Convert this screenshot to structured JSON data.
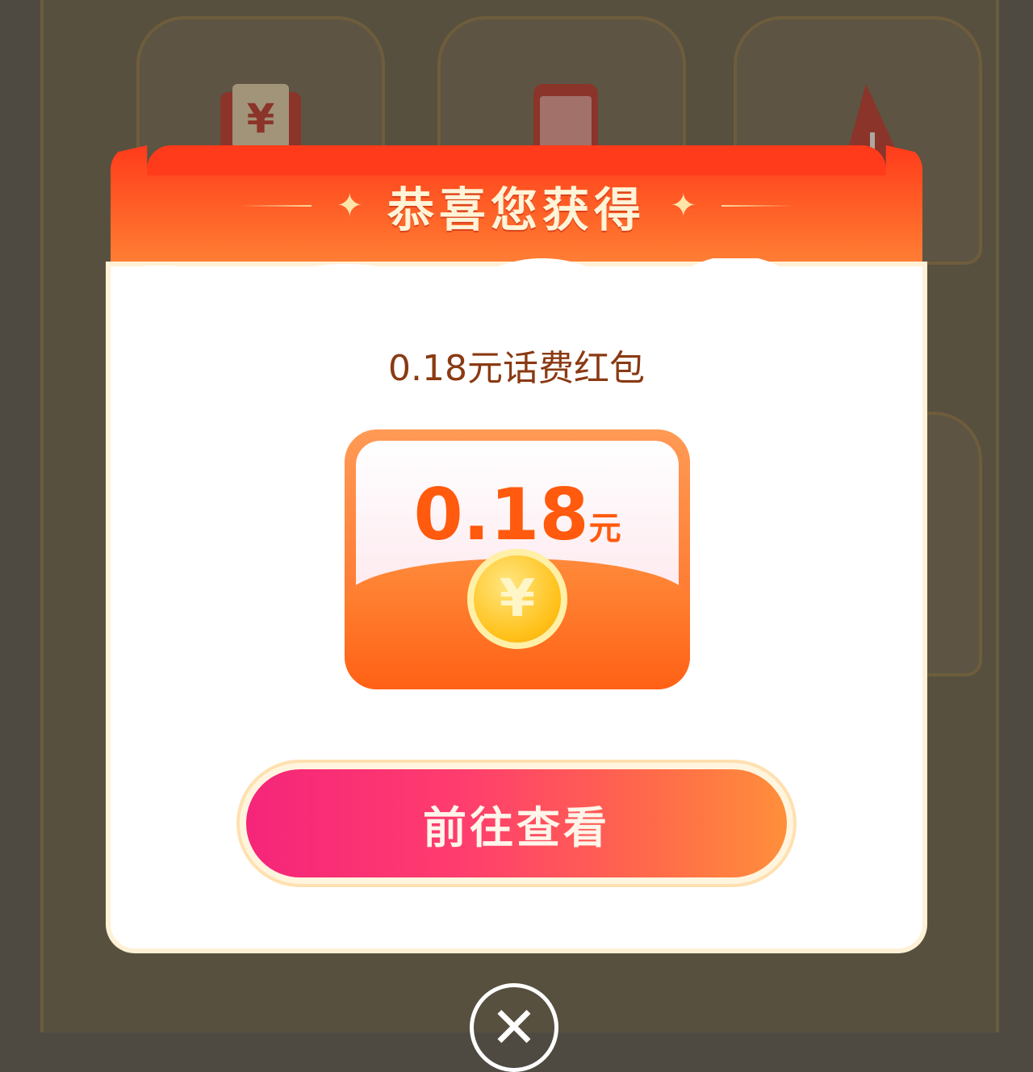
{
  "background": {
    "cards": [
      {
        "icon": "red-envelope-yuan-icon",
        "symbol": "¥"
      },
      {
        "icon": "phone-icon",
        "symbol": ""
      },
      {
        "icon": "red-sail-icon",
        "symbol": ""
      }
    ]
  },
  "modal": {
    "title": "恭喜您获得",
    "prize_name": "0.18元话费红包",
    "amount_value": "0.18",
    "amount_unit": "元",
    "coin_symbol": "¥",
    "cta_label": "前往查看",
    "close_icon": "close-icon"
  },
  "colors": {
    "header_red": "#ff3b1c",
    "amount_orange": "#ff5a0d",
    "cta_pink": "#f5257a",
    "coin_gold": "#ffc11a"
  }
}
